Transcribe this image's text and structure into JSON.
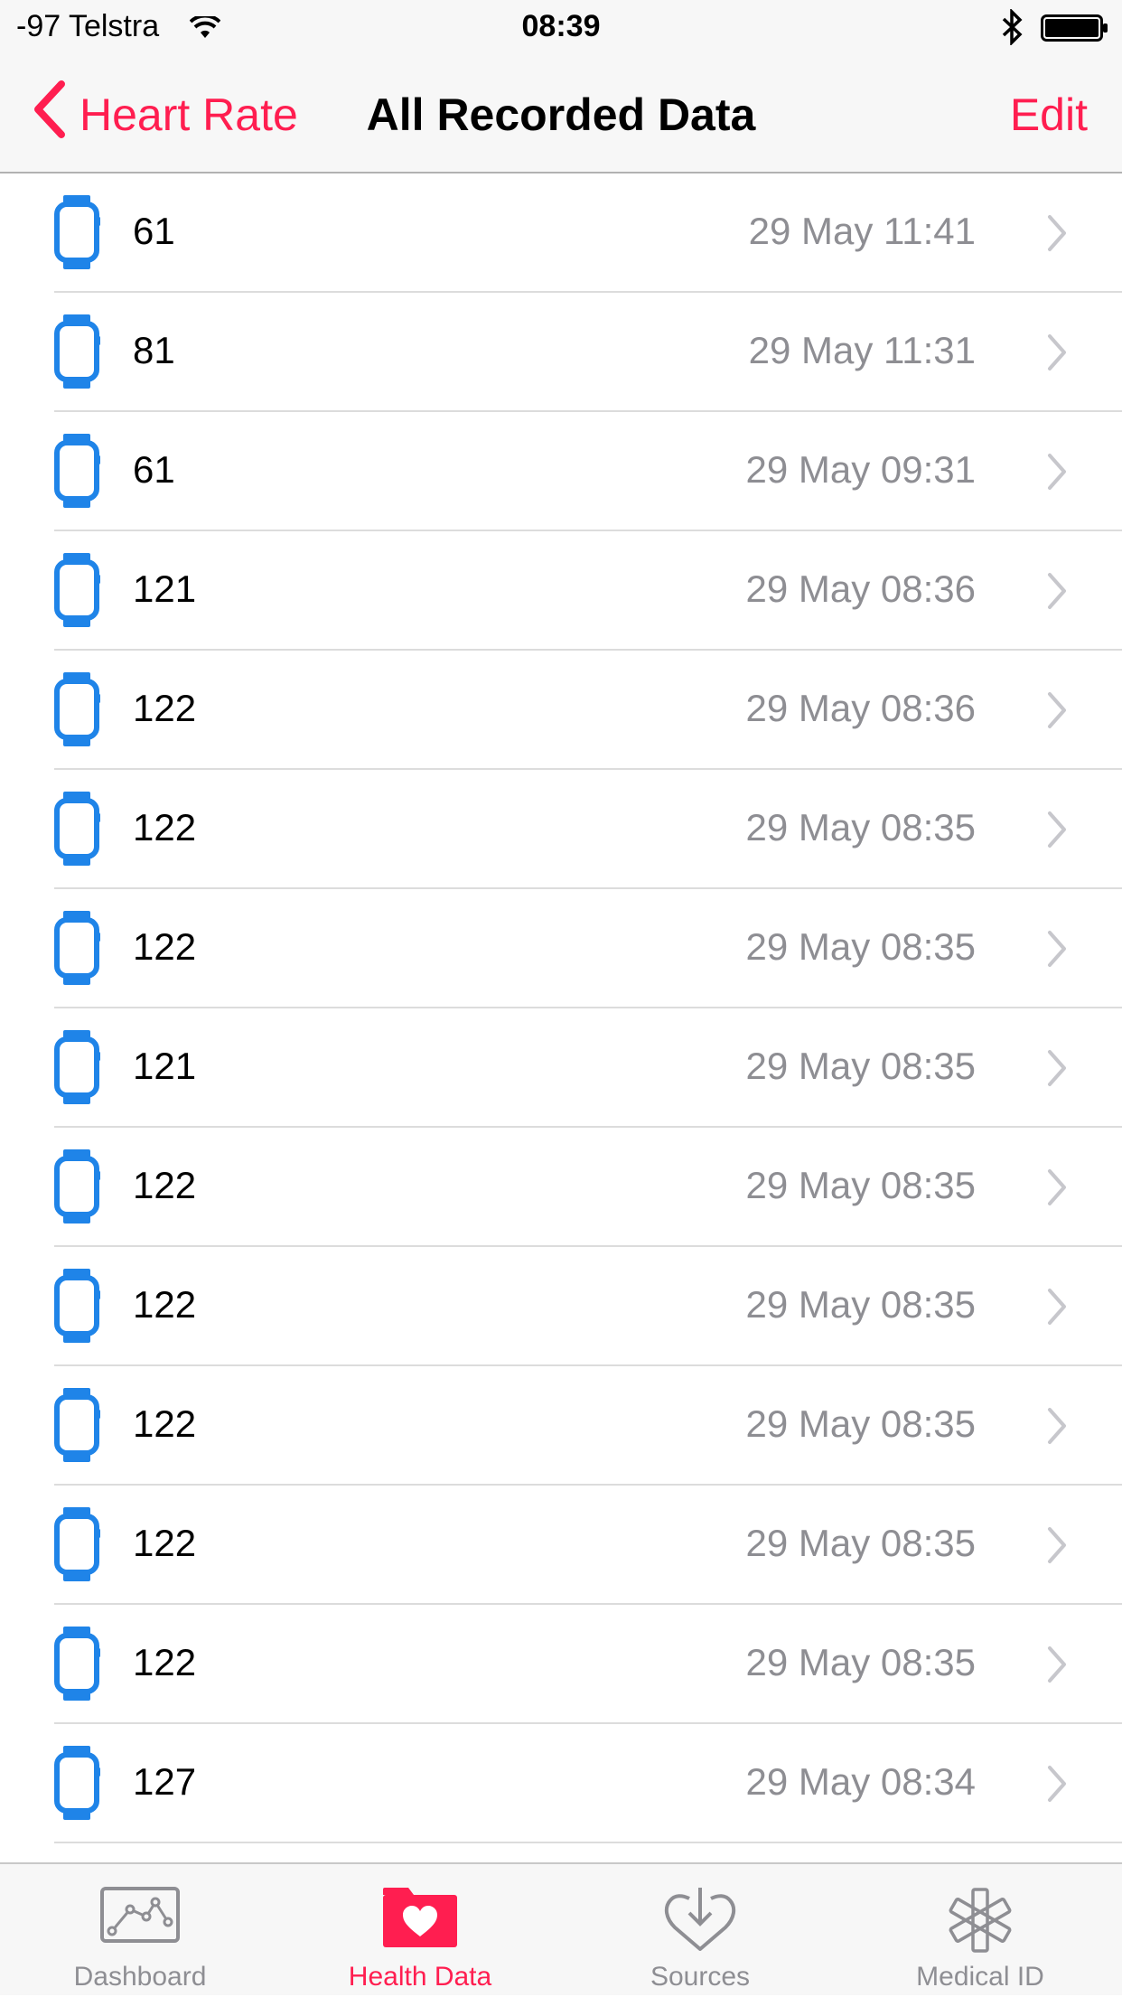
{
  "status_bar": {
    "carrier": "-97 Telstra",
    "time": "08:39"
  },
  "nav": {
    "back_label": "Heart Rate",
    "title": "All Recorded Data",
    "edit_label": "Edit"
  },
  "rows": [
    {
      "value": "61",
      "date": "29 May 11:41"
    },
    {
      "value": "81",
      "date": "29 May 11:31"
    },
    {
      "value": "61",
      "date": "29 May 09:31"
    },
    {
      "value": "121",
      "date": "29 May 08:36"
    },
    {
      "value": "122",
      "date": "29 May 08:36"
    },
    {
      "value": "122",
      "date": "29 May 08:35"
    },
    {
      "value": "122",
      "date": "29 May 08:35"
    },
    {
      "value": "121",
      "date": "29 May 08:35"
    },
    {
      "value": "122",
      "date": "29 May 08:35"
    },
    {
      "value": "122",
      "date": "29 May 08:35"
    },
    {
      "value": "122",
      "date": "29 May 08:35"
    },
    {
      "value": "122",
      "date": "29 May 08:35"
    },
    {
      "value": "122",
      "date": "29 May 08:35"
    },
    {
      "value": "127",
      "date": "29 May 08:34"
    }
  ],
  "tabs": [
    {
      "label": "Dashboard",
      "icon": "dashboard-chart-icon"
    },
    {
      "label": "Health Data",
      "icon": "health-data-folder-heart-icon"
    },
    {
      "label": "Sources",
      "icon": "sources-download-heart-icon"
    },
    {
      "label": "Medical ID",
      "icon": "medical-id-asterisk-icon"
    }
  ],
  "colors": {
    "accent": "#ff1e50",
    "watch_icon": "#1f84e8",
    "secondary_text": "#8e8e93"
  }
}
